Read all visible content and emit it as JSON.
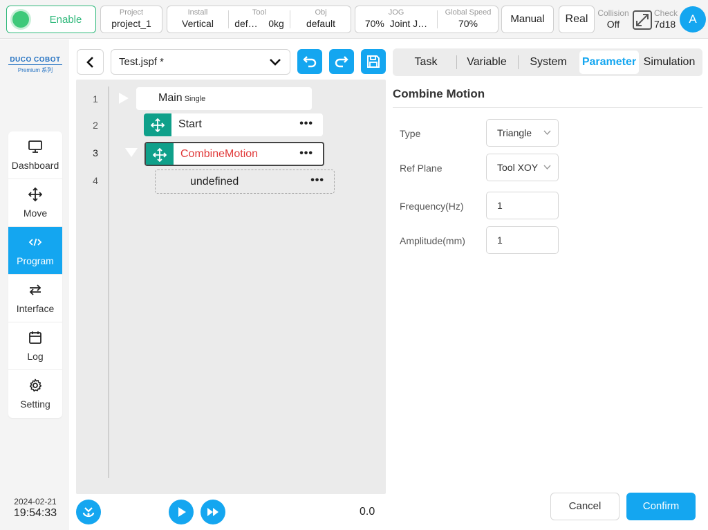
{
  "topbar": {
    "enable_label": "Enable",
    "project": {
      "key": "Project",
      "value": "project_1"
    },
    "install": {
      "key": "Install",
      "value": "Vertical"
    },
    "tool": {
      "key": "Tool",
      "name": "def…",
      "weight": "0kg"
    },
    "obj": {
      "key": "Obj",
      "value": "default"
    },
    "jog": {
      "key": "JOG",
      "percent": "70%",
      "mode": "Joint J…"
    },
    "global_speed": {
      "key": "Global Speed",
      "value": "70%"
    },
    "manual_label": "Manual",
    "real_label": "Real",
    "collision": {
      "key": "Collision",
      "value": "Off"
    },
    "check": {
      "key": "Check",
      "value": "7d18"
    },
    "avatar_letter": "A"
  },
  "sidebar": {
    "logo_line1": "DUCO COBOT",
    "logo_line2": "Premium 系列",
    "items": [
      {
        "label": "Dashboard",
        "icon": "monitor-icon"
      },
      {
        "label": "Move",
        "icon": "move-icon"
      },
      {
        "label": "Program",
        "icon": "code-icon",
        "active": true
      },
      {
        "label": "Interface",
        "icon": "swap-icon"
      },
      {
        "label": "Log",
        "icon": "calendar-icon"
      },
      {
        "label": "Setting",
        "icon": "gear-icon"
      }
    ],
    "date": "2024-02-21",
    "time": "19:54:33"
  },
  "editor": {
    "file_name": "Test.jspf *",
    "line_numbers": [
      "1",
      "2",
      "3",
      "4"
    ],
    "nodes": {
      "main": {
        "label": "Main",
        "mode": "Single"
      },
      "start": {
        "label": "Start"
      },
      "combine": {
        "label": "CombineMotion"
      },
      "undefined": {
        "label": "undefined"
      }
    },
    "speed_value": "0.0"
  },
  "right_panel": {
    "tabs": [
      "Task",
      "Variable",
      "System",
      "Parameter",
      "Simulation"
    ],
    "active_tab": "Parameter",
    "title": "Combine Motion",
    "params": {
      "type": {
        "label": "Type",
        "value": "Triangle"
      },
      "ref_plane": {
        "label": "Ref Plane",
        "value": "Tool XOY"
      },
      "frequency": {
        "label": "Frequency(Hz)",
        "value": "1"
      },
      "amplitude": {
        "label": "Amplitude(mm)",
        "value": "1"
      }
    },
    "cancel_label": "Cancel",
    "confirm_label": "Confirm"
  },
  "colors": {
    "accent": "#14a6f0",
    "enable_green": "#2eb87a",
    "node_handle": "#0fa08a",
    "selected_text": "#e03a3a"
  }
}
